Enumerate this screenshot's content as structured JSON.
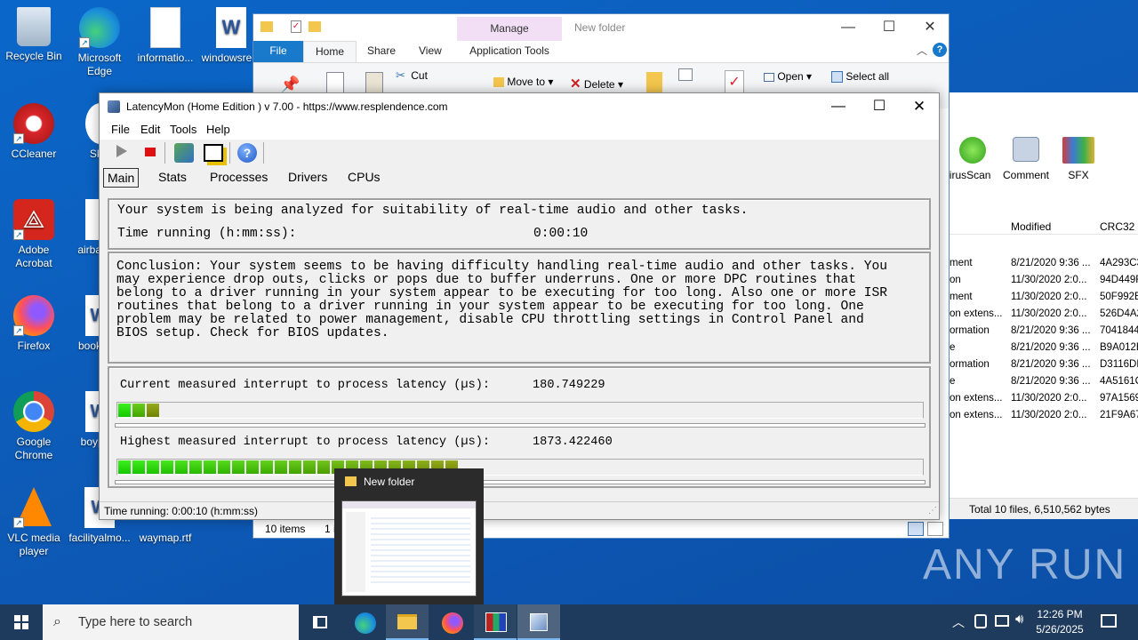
{
  "desktop": {
    "icons": [
      {
        "label": "Recycle Bin"
      },
      {
        "label": "Microsoft Edge"
      },
      {
        "label": "informatio..."
      },
      {
        "label": "windowsre..."
      },
      {
        "label": "CCleaner"
      },
      {
        "label": "Sky..."
      },
      {
        "label": "Adobe Acrobat"
      },
      {
        "label": "airbas..."
      },
      {
        "label": "Firefox"
      },
      {
        "label": "bookc..."
      },
      {
        "label": "Google Chrome"
      },
      {
        "label": "boypr..."
      },
      {
        "label": "VLC media player"
      },
      {
        "label": "facilityalmo..."
      },
      {
        "label": "waymap.rtf"
      }
    ],
    "watermark": "ANY RUN"
  },
  "explorer": {
    "title": "New folder",
    "manage_label": "Manage",
    "tabs": [
      "File",
      "Home",
      "Share",
      "View",
      "Application Tools"
    ],
    "ribbon": {
      "cut": "Cut",
      "move_to": "Move to",
      "delete": "Delete",
      "open": "Open",
      "select_all": "Select all"
    },
    "status_items": "10 items",
    "status_selected": "1 ite"
  },
  "archive": {
    "toolbar": [
      "VirusScan",
      "Comment",
      "SFX"
    ],
    "columns": {
      "modified": "Modified",
      "crc": "CRC32"
    },
    "rows": [
      {
        "name": "ment",
        "modified": "8/21/2020 9:36 ...",
        "crc": "4A293C3"
      },
      {
        "name": "on",
        "modified": "11/30/2020 2:0...",
        "crc": "94D449F"
      },
      {
        "name": "ment",
        "modified": "11/30/2020 2:0...",
        "crc": "50F992B"
      },
      {
        "name": "on extens...",
        "modified": "11/30/2020 2:0...",
        "crc": "526D4A2"
      },
      {
        "name": "ormation",
        "modified": "8/21/2020 9:36 ...",
        "crc": "7041844"
      },
      {
        "name": "e",
        "modified": "8/21/2020 9:36 ...",
        "crc": "B9A012E"
      },
      {
        "name": "ormation",
        "modified": "8/21/2020 9:36 ...",
        "crc": "D3116DF"
      },
      {
        "name": "e",
        "modified": "8/21/2020 9:36 ...",
        "crc": "4A5161C"
      },
      {
        "name": "on extens...",
        "modified": "11/30/2020 2:0...",
        "crc": "97A1569"
      },
      {
        "name": "on extens...",
        "modified": "11/30/2020 2:0...",
        "crc": "21F9A67"
      }
    ],
    "status": "Total 10 files, 6,510,562 bytes"
  },
  "latencymon": {
    "title": "LatencyMon  (Home Edition )  v 7.00 - https://www.resplendence.com",
    "menu": [
      "File",
      "Edit",
      "Tools",
      "Help"
    ],
    "tabs": [
      "Main",
      "Stats",
      "Processes",
      "Drivers",
      "CPUs"
    ],
    "analyzing": "Your system is being analyzed for suitability of real-time audio and other tasks.",
    "time_running_label": "Time running (h:mm:ss):",
    "time_running_value": "0:00:10",
    "conclusion": [
      "Conclusion: Your system seems to be having difficulty handling real-time audio and other tasks. You",
      "may experience drop outs, clicks or pops due to buffer underruns. One or more DPC routines that",
      "belong to a driver running in your system appear to be executing for too long. Also one or more ISR",
      "routines that belong to a driver running in your system appear to be executing for too long. One",
      "problem may be related to power management, disable CPU throttling settings in Control Panel and",
      "BIOS setup. Check for BIOS updates."
    ],
    "current_label": "Current measured interrupt to process latency (µs):",
    "current_value": "180.749229",
    "current_level": 0.05,
    "highest_label": "Highest measured interrupt to process latency (µs):",
    "highest_value": "1873.422460",
    "highest_level": 0.42,
    "status": "Time running: 0:00:10  (h:mm:ss)"
  },
  "taskbar": {
    "search_placeholder": "Type here to search",
    "time": "12:26 PM",
    "date": "5/26/2025",
    "thumbnail_title": "New folder"
  }
}
